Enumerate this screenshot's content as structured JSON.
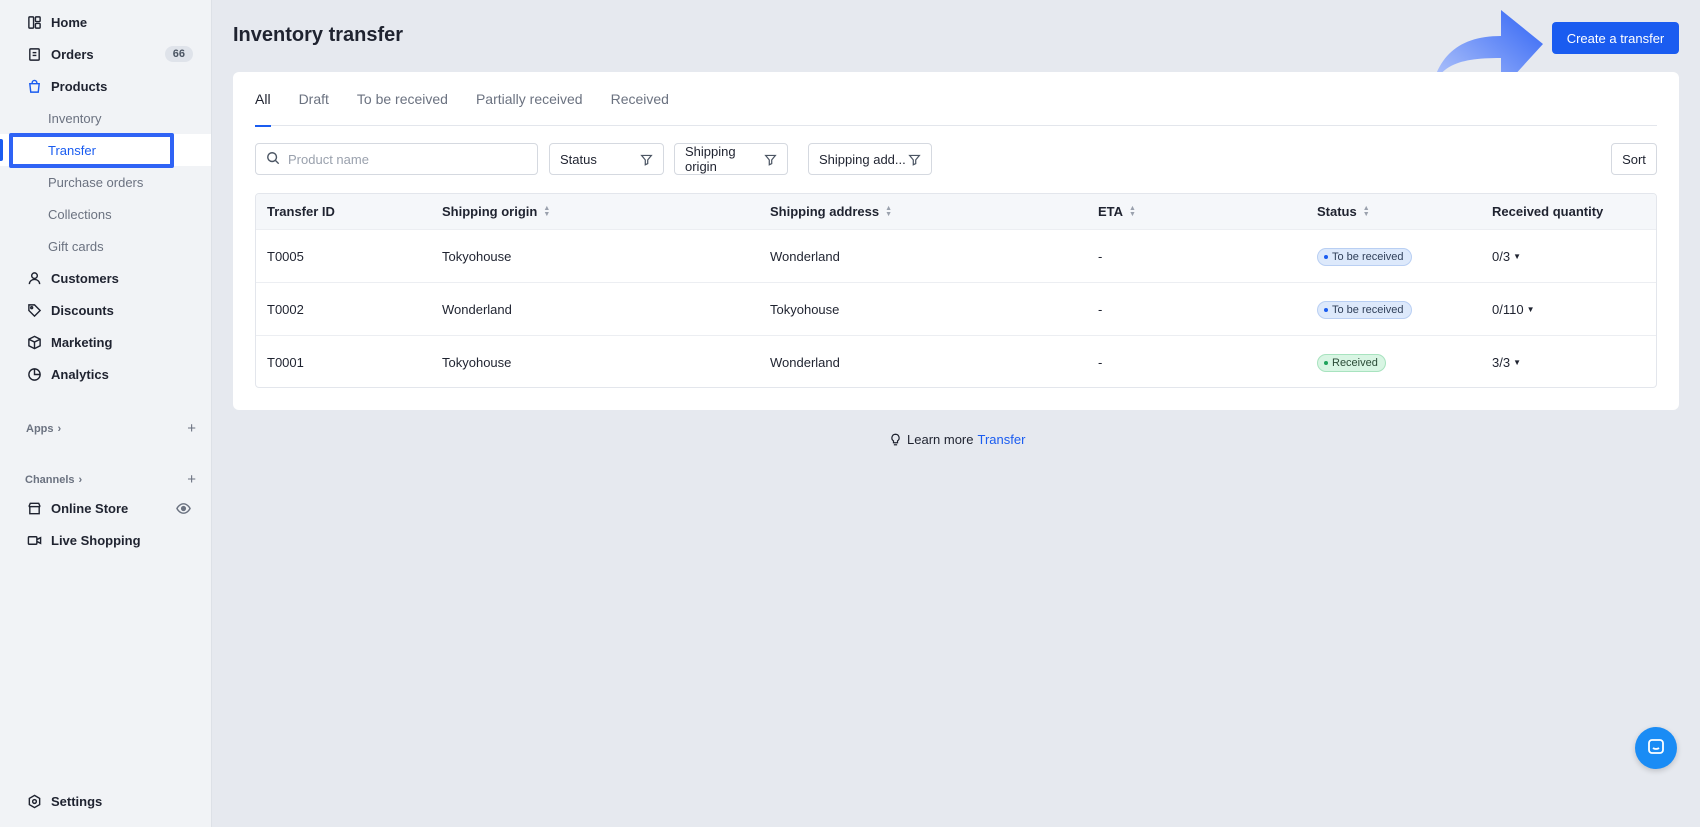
{
  "sidebar": {
    "home": "Home",
    "orders": "Orders",
    "orders_count": "66",
    "products": "Products",
    "sub_items": [
      "Inventory",
      "Transfer",
      "Purchase orders",
      "Collections",
      "Gift cards"
    ],
    "customers": "Customers",
    "discounts": "Discounts",
    "marketing": "Marketing",
    "analytics": "Analytics",
    "apps_label": "Apps",
    "channels_label": "Channels",
    "online_store": "Online Store",
    "live_shopping": "Live Shopping",
    "settings": "Settings"
  },
  "header": {
    "title": "Inventory transfer",
    "create_button": "Create a transfer"
  },
  "tabs": [
    "All",
    "Draft",
    "To be received",
    "Partially received",
    "Received"
  ],
  "filters": {
    "search_placeholder": "Product name",
    "status": "Status",
    "shipping_origin": "Shipping origin",
    "shipping_address": "Shipping add...",
    "sort": "Sort"
  },
  "table": {
    "columns": [
      "Transfer ID",
      "Shipping origin",
      "Shipping address",
      "ETA",
      "Status",
      "Received quantity"
    ],
    "rows": [
      {
        "id": "T0005",
        "origin": "Tokyohouse",
        "address": "Wonderland",
        "eta": "-",
        "status": "To be received",
        "qty": "0/3"
      },
      {
        "id": "T0002",
        "origin": "Wonderland",
        "address": "Tokyohouse",
        "eta": "-",
        "status": "To be received",
        "qty": "0/110"
      },
      {
        "id": "T0001",
        "origin": "Tokyohouse",
        "address": "Wonderland",
        "eta": "-",
        "status": "Received",
        "qty": "3/3"
      }
    ]
  },
  "footer": {
    "learn_more": "Learn more",
    "learn_link": "Transfer"
  },
  "colors": {
    "accent": "#1a5cf0",
    "to_be_received": "#dde9fb",
    "received": "#d8f5e3"
  }
}
